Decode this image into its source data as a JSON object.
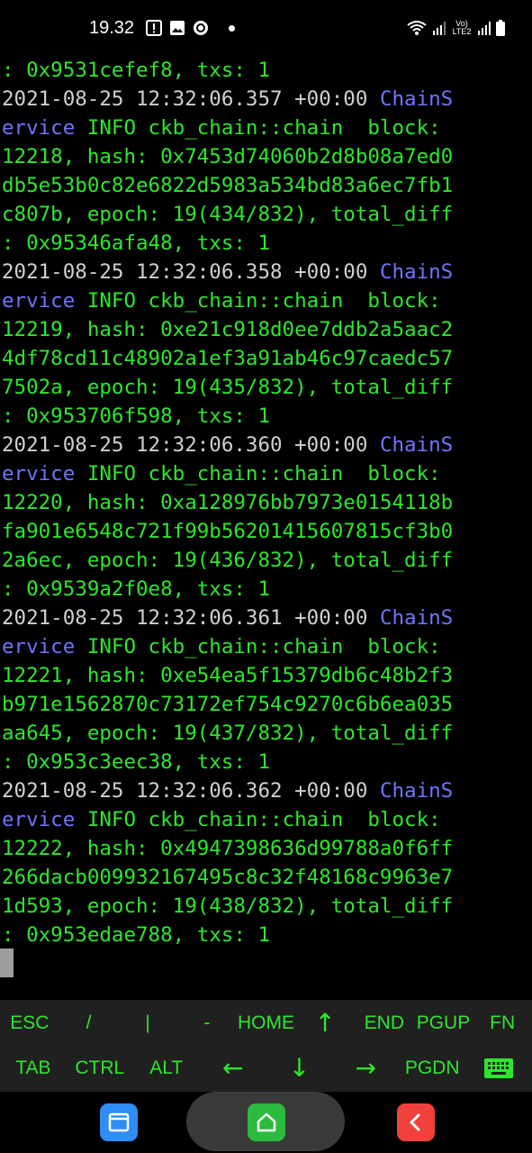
{
  "status_bar": {
    "time": "19.32",
    "network": "Vo) LTE2"
  },
  "terminal": {
    "lines": [
      [
        {
          "t": ": 0x9531cefef8, txs: 1",
          "c": ""
        }
      ],
      [
        {
          "t": "2021-08-25 12:32:06.357 +00:00 ",
          "c": "white"
        },
        {
          "t": "ChainS",
          "c": "blue"
        }
      ],
      [
        {
          "t": "ervice",
          "c": "blue"
        },
        {
          "t": " INFO ckb_chain::chain  block:",
          "c": ""
        }
      ],
      [
        {
          "t": "12218, hash: 0x7453d74060b2d8b08a7ed0",
          "c": ""
        }
      ],
      [
        {
          "t": "db5e53b0c82e6822d5983a534bd83a6ec7fb1",
          "c": ""
        }
      ],
      [
        {
          "t": "c807b, epoch: 19(434/832), total_diff",
          "c": ""
        }
      ],
      [
        {
          "t": ": 0x95346afa48, txs: 1",
          "c": ""
        }
      ],
      [
        {
          "t": "2021-08-25 12:32:06.358 +00:00 ",
          "c": "white"
        },
        {
          "t": "ChainS",
          "c": "blue"
        }
      ],
      [
        {
          "t": "ervice",
          "c": "blue"
        },
        {
          "t": " INFO ckb_chain::chain  block:",
          "c": ""
        }
      ],
      [
        {
          "t": "12219, hash: 0xe21c918d0ee7ddb2a5aac2",
          "c": ""
        }
      ],
      [
        {
          "t": "4df78cd11c48902a1ef3a91ab46c97caedc57",
          "c": ""
        }
      ],
      [
        {
          "t": "7502a, epoch: 19(435/832), total_diff",
          "c": ""
        }
      ],
      [
        {
          "t": ": 0x953706f598, txs: 1",
          "c": ""
        }
      ],
      [
        {
          "t": "2021-08-25 12:32:06.360 +00:00 ",
          "c": "white"
        },
        {
          "t": "ChainS",
          "c": "blue"
        }
      ],
      [
        {
          "t": "ervice",
          "c": "blue"
        },
        {
          "t": " INFO ckb_chain::chain  block:",
          "c": ""
        }
      ],
      [
        {
          "t": "12220, hash: 0xa128976bb7973e0154118b",
          "c": ""
        }
      ],
      [
        {
          "t": "fa901e6548c721f99b56201415607815cf3b0",
          "c": ""
        }
      ],
      [
        {
          "t": "2a6ec, epoch: 19(436/832), total_diff",
          "c": ""
        }
      ],
      [
        {
          "t": ": 0x9539a2f0e8, txs: 1",
          "c": ""
        }
      ],
      [
        {
          "t": "2021-08-25 12:32:06.361 +00:00 ",
          "c": "white"
        },
        {
          "t": "ChainS",
          "c": "blue"
        }
      ],
      [
        {
          "t": "ervice",
          "c": "blue"
        },
        {
          "t": " INFO ckb_chain::chain  block:",
          "c": ""
        }
      ],
      [
        {
          "t": "12221, hash: 0xe54ea5f15379db6c48b2f3",
          "c": ""
        }
      ],
      [
        {
          "t": "b971e1562870c73172ef754c9270c6b6ea035",
          "c": ""
        }
      ],
      [
        {
          "t": "aa645, epoch: 19(437/832), total_diff",
          "c": ""
        }
      ],
      [
        {
          "t": ": 0x953c3eec38, txs: 1",
          "c": ""
        }
      ],
      [
        {
          "t": "2021-08-25 12:32:06.362 +00:00 ",
          "c": "white"
        },
        {
          "t": "ChainS",
          "c": "blue"
        }
      ],
      [
        {
          "t": "ervice",
          "c": "blue"
        },
        {
          "t": " INFO ckb_chain::chain  block:",
          "c": ""
        }
      ],
      [
        {
          "t": "12222, hash: 0x4947398636d99788a0f6ff",
          "c": ""
        }
      ],
      [
        {
          "t": "266dacb009932167495c8c32f48168c9963e7",
          "c": ""
        }
      ],
      [
        {
          "t": "1d593, epoch: 19(438/832), total_diff",
          "c": ""
        }
      ],
      [
        {
          "t": ": 0x953edae788, txs: 1",
          "c": ""
        }
      ]
    ]
  },
  "extra_keys": {
    "row1": [
      {
        "label": "ESC",
        "name": "key-esc"
      },
      {
        "label": "/",
        "name": "key-slash"
      },
      {
        "label": "|",
        "name": "key-pipe"
      },
      {
        "label": "-",
        "name": "key-dash"
      },
      {
        "label": "HOME",
        "name": "key-home"
      },
      {
        "label": "↑",
        "name": "key-arrow-up"
      },
      {
        "label": "END",
        "name": "key-end"
      },
      {
        "label": "PGUP",
        "name": "key-pgup"
      },
      {
        "label": "FN",
        "name": "key-fn"
      }
    ],
    "row2": [
      {
        "label": "TAB",
        "name": "key-tab"
      },
      {
        "label": "CTRL",
        "name": "key-ctrl"
      },
      {
        "label": "ALT",
        "name": "key-alt"
      },
      {
        "label": "←",
        "name": "key-arrow-left"
      },
      {
        "label": "↓",
        "name": "key-arrow-down"
      },
      {
        "label": "→",
        "name": "key-arrow-right"
      },
      {
        "label": "PGDN",
        "name": "key-pgdn"
      },
      {
        "label": "",
        "name": "key-keyboard",
        "icon": "keyboard-icon"
      }
    ]
  },
  "colors": {
    "terminal_green": "#2ee62e",
    "terminal_blue": "#6f74ff",
    "keys_bg": "#202020"
  },
  "nav": {
    "icons": [
      "recent-apps-icon",
      "home-icon",
      "back-icon"
    ]
  }
}
